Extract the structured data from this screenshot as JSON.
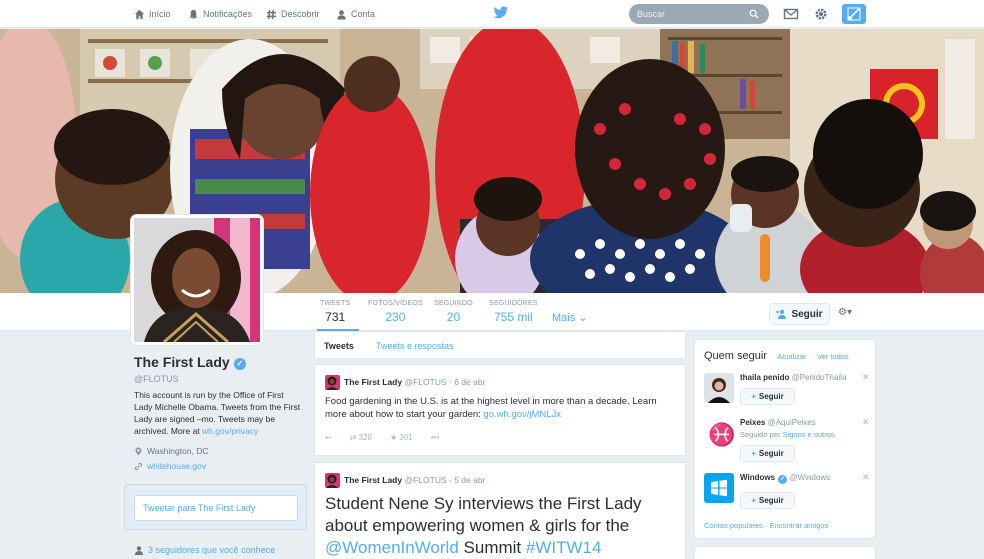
{
  "topnav": {
    "home": "Início",
    "notifications": "Notificações",
    "discover": "Descobrir",
    "account": "Conta",
    "search_placeholder": "Buscar"
  },
  "profile": {
    "name": "The First Lady",
    "handle": "@FLOTUS",
    "bio_text": "This account is run by the Office of First Lady Michelle Obama. Tweets from the First Lady are signed –mo. Tweets may be archived. More at ",
    "bio_link": "wh.gov/privacy",
    "location": "Washington, DC",
    "website": "whitehouse.gov",
    "tweet_to_label": "Tweetar para The First Lady",
    "followers_you_know": "3 seguidores que você conhece"
  },
  "stats": [
    {
      "label": "TWEETS",
      "value": "731"
    },
    {
      "label": "FOTOS/VÍDEOS",
      "value": "230"
    },
    {
      "label": "SEGUINDO",
      "value": "20"
    },
    {
      "label": "SEGUIDORES",
      "value": "755 mil"
    }
  ],
  "more_label": "Mais",
  "follow_label": "Seguir",
  "tabs": {
    "tweets": "Tweets",
    "replies": "Tweets e respostas"
  },
  "tweets": [
    {
      "name": "The First Lady",
      "handle": "@FLOTUS",
      "date": "6 de abr",
      "text": "Food gardening in the U.S. is at the highest level in more than a decade. Learn more about how to start your garden: ",
      "link": "go.wh.gov/jMNLJx",
      "retweets": "328",
      "favorites": "301"
    },
    {
      "name": "The First Lady",
      "handle": "@FLOTUS",
      "date": "5 de abr",
      "text": "Student Nene Sy interviews the First Lady about empowering women & girls for the ",
      "mention": "@WomenInWorld",
      "mid": " Summit ",
      "hashtag": "#WITW14"
    }
  ],
  "who_to_follow": {
    "title": "Quem seguir",
    "refresh": "Atualizar",
    "view_all": "Ver todos",
    "suggestions": [
      {
        "name": "thaila penido",
        "handle": "@PenidoThaila",
        "sub": "",
        "button": "Seguir"
      },
      {
        "name": "Peixes",
        "handle": "@AquiPeixes",
        "sub_prefix": "Seguido por ",
        "sub_link1": "Signos",
        "sub_mid": " e ",
        "sub_link2": "outros",
        "button": "Seguir"
      },
      {
        "name": "Windows",
        "handle": "@Windows",
        "sub": "",
        "button": "Seguir"
      }
    ],
    "popular": "Contas populares",
    "find_friends": "Encontrar amigos"
  },
  "colors": {
    "accent": "#55acee",
    "text": "#292f33",
    "muted": "#8899a6",
    "background": "#e9eef2"
  }
}
